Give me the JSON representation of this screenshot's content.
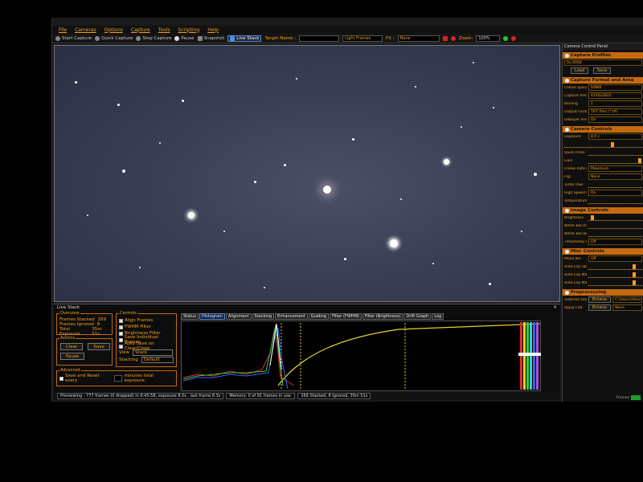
{
  "menu": [
    "File",
    "Cameras",
    "Options",
    "Capture",
    "Tools",
    "Scripting",
    "Help"
  ],
  "toolbar": {
    "start_capture": "Start Capture",
    "quick_capture": "Quick Capture",
    "stop_capture": "Stop Capture",
    "pause": "Pause",
    "snapshot": "Snapshot",
    "live_stack": "Live Stack",
    "target_name_label": "Target Name :",
    "target_name_value": "",
    "frame_type": "Light Frames",
    "fx_label": "FX :",
    "fx_value": "None",
    "zoom_label": "Zoom:",
    "zoom_value": "100%"
  },
  "right_panel": {
    "title": "Camera Control Panel",
    "capture_profiles": {
      "heading": "Capture Profiles",
      "profile": "Sn.0058",
      "load": "Load",
      "save": "Save"
    },
    "capture_format": {
      "heading": "Capture Format and Area",
      "rows": [
        {
          "k": "Colour Space",
          "v": "RAW8"
        },
        {
          "k": "Capture Area",
          "v": "4144x2822"
        },
        {
          "k": "Binning",
          "v": "1"
        },
        {
          "k": "Output Format",
          "v": "TIFF files (*.tif)"
        },
        {
          "k": "Debayer Preview",
          "v": "On"
        }
      ]
    },
    "camera_controls": {
      "heading": "Camera Controls",
      "exposure_label": "Exposure",
      "exposure_value": "8.0 s",
      "quick_picks": "Quick Picks",
      "rows": [
        {
          "k": "Gain",
          "v": ""
        },
        {
          "k": "Frame Rate Limit",
          "v": "Maximum"
        },
        {
          "k": "Flip",
          "v": "None"
        },
        {
          "k": "Turbo USB",
          "v": ""
        },
        {
          "k": "High Speed Mode",
          "v": "On"
        },
        {
          "k": "Temperature",
          "v": ""
        }
      ]
    },
    "image_controls": {
      "heading": "Image Controls",
      "rows": [
        {
          "k": "Brightness",
          "v": ""
        },
        {
          "k": "White Bal (R)",
          "v": ""
        },
        {
          "k": "White Bal (B)",
          "v": ""
        },
        {
          "k": "Timestamp Frames",
          "v": "Off"
        }
      ]
    },
    "misc_controls": {
      "heading": "Misc Controls",
      "rows": [
        {
          "k": "Mono Bin",
          "v": "Off"
        },
        {
          "k": "Auto Exp Target Brightness",
          "v": ""
        },
        {
          "k": "Auto Exp Max Exp M S",
          "v": ""
        },
        {
          "k": "Auto Exp Max Gain",
          "v": ""
        }
      ]
    },
    "preprocessing": {
      "heading": "Preprocessing",
      "rows": [
        {
          "k": "Subtract Dark",
          "btn": "Browse",
          "v": "C:\\Users\\Hmnr\\Desktop..."
        },
        {
          "k": "Apply Flat",
          "btn": "Browse",
          "v": "None"
        }
      ]
    },
    "status": "Frames"
  },
  "live_stack": {
    "title": "Live Stack",
    "overview": {
      "heading": "Overview",
      "frames_stacked_label": "Frames Stacked",
      "frames_stacked": "269",
      "frames_ignored_label": "Frames Ignored",
      "frames_ignored": "8",
      "total_exposure_label": "Total Exposure",
      "total_exposure": "35m 51s"
    },
    "actions": {
      "heading": "Actions",
      "clear": "Clear",
      "save": "Save",
      "pause": "Pause"
    },
    "controls": {
      "heading": "Controls",
      "checks": [
        {
          "label": "Align Frames",
          "checked": true
        },
        {
          "label": "FWHM Filter",
          "checked": true
        },
        {
          "label": "Brightness Filter",
          "checked": false
        },
        {
          "label": "Save Individual Frames",
          "checked": false
        },
        {
          "label": "Auto Save on Clear/Close",
          "checked": true
        }
      ],
      "view_label": "View",
      "view_value": "Stack",
      "stacking_label": "Stacking",
      "stacking_value": "Default"
    },
    "advanced": {
      "heading": "Advanced",
      "save_reset_label": "Save and Reset every",
      "minutes_label": "minutes total exposure"
    },
    "tabs": [
      "Status",
      "Histogram",
      "Alignment",
      "Stacking",
      "Enhancement",
      "Guiding",
      "Filter (FWHM)",
      "Filter (Brightness)",
      "Drift Graph",
      "Log"
    ],
    "active_tab": "Histogram"
  },
  "status_bar": {
    "preview": "Previewing : 777 frames (0 dropped) in 0:45:58, exposure 8.0s , last frame 8.3s",
    "memory": "Memory: 0 of 91 frames in use.",
    "stack": "269 Stacked, 8 Ignored, 35m 51s"
  },
  "colors": {
    "accent": "#f0a020",
    "panel_header": "#c56a10",
    "sky": "#373d52"
  }
}
